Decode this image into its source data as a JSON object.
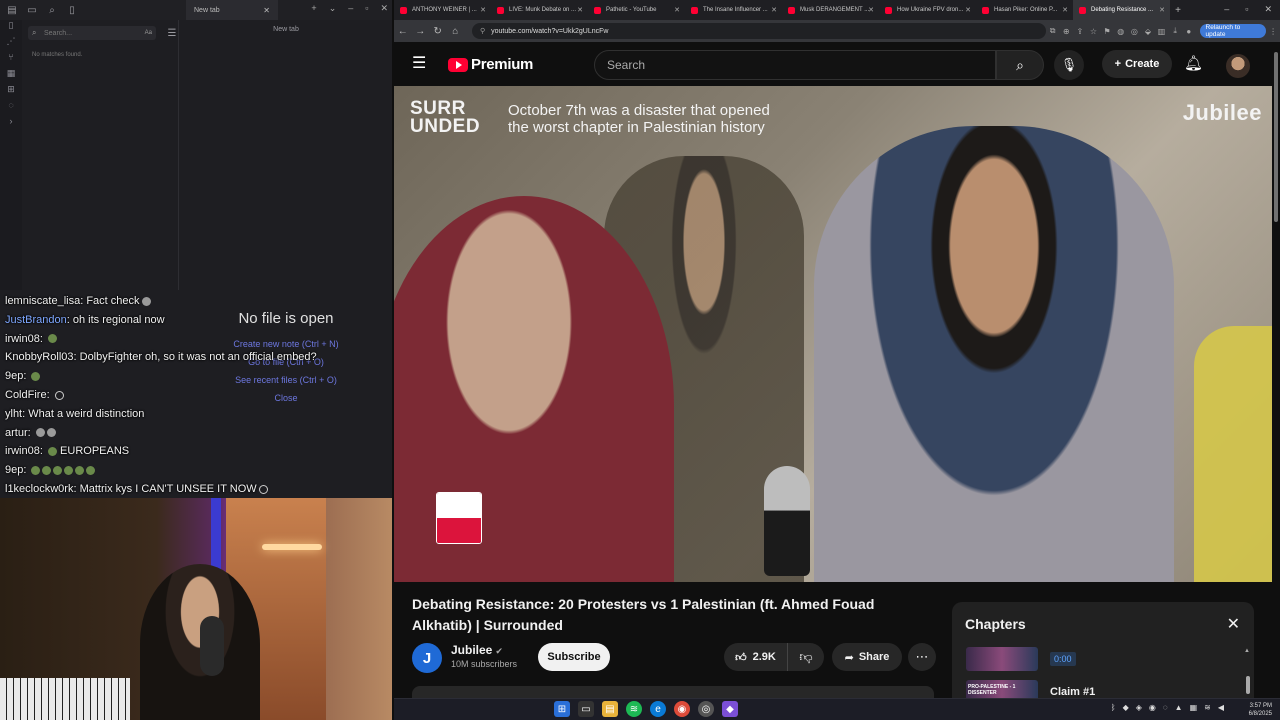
{
  "editor": {
    "tab_label": "New tab",
    "search_placeholder": "Search...",
    "search_option": "Aa",
    "no_matches": "No matches found.",
    "pane_header": "New tab",
    "empty_title": "No file is open",
    "links": [
      "Create new note (Ctrl + N)",
      "Go to file (Ctrl + O)",
      "See recent files (Ctrl + O)",
      "Close"
    ]
  },
  "chat": {
    "messages": [
      {
        "user": "lemniscate_lisa",
        "text": "Fact check",
        "emote": "gray"
      },
      {
        "user": "JustBrandon",
        "text": "oh its regional now",
        "blue": true
      },
      {
        "user": "irwin08",
        "text": "",
        "emote": "green"
      },
      {
        "user": "KnobbyRoll03",
        "text": "DolbyFighter oh, so it was not an official embed?"
      },
      {
        "user": "9ep",
        "text": "",
        "emote": "green"
      },
      {
        "user": "ColdFire",
        "text": "",
        "emote": "ring"
      },
      {
        "user": "ylht",
        "text": "What a weird distinction"
      },
      {
        "user": "artur",
        "text": "",
        "emote": "gray"
      },
      {
        "user": "irwin08",
        "text": "EUROPEANS",
        "emote": "green"
      },
      {
        "user": "9ep",
        "text": "",
        "emote": "green"
      },
      {
        "user": "l1keclockw0rk",
        "text": "Mattrix kys I CAN'T UNSEE IT NOW",
        "emote": "ring"
      }
    ]
  },
  "browser": {
    "tabs": [
      "ANTHONY WEINER | ...",
      "LIVE: Munk Debate on ...",
      "Pathetic - YouTube",
      "The Insane Influencer ...",
      "Musk DERANGEMENT ...",
      "How Ukraine FPV dron...",
      "Hasan Piker: Online P...",
      "Debating Resistance ..."
    ],
    "active_tab": 7,
    "url": "youtube.com/watch?v=Ukk2gULncFw",
    "relaunch_label": "Relaunch to update"
  },
  "youtube": {
    "logo_text": "Premium",
    "search_placeholder": "Search",
    "create_label": "Create",
    "video": {
      "overlay_brand": "SURR UNDED",
      "overlay_subtitle_1": "October 7th was a disaster that opened",
      "overlay_subtitle_2": "the worst chapter in Palestinian history",
      "watermark": "Jubilee",
      "title": "Debating Resistance: 20 Protesters vs 1 Palestinian (ft. Ahmed Fouad Alkhatib) | Surrounded"
    },
    "channel": {
      "avatar_letter": "J",
      "name": "Jubilee",
      "verified_mark": "✔",
      "subscribers": "10M subscribers",
      "subscribe_label": "Subscribe"
    },
    "likes": "2.9K",
    "share_label": "Share",
    "description_peek": "",
    "chapters": {
      "title": "Chapters",
      "items": [
        {
          "thumb_text": "",
          "time": "0:00",
          "name": ""
        },
        {
          "thumb_text": "PRO-PALESTINE - 1 DISSENTER",
          "time": "",
          "name": "Claim #1"
        }
      ]
    }
  },
  "clock": {
    "time": "3:57 PM",
    "date": "6/8/2025"
  },
  "colors": {
    "yt_red": "#ff0033",
    "accent_blue": "#3f7ad8",
    "chat_blue": "#7ea7ff"
  }
}
